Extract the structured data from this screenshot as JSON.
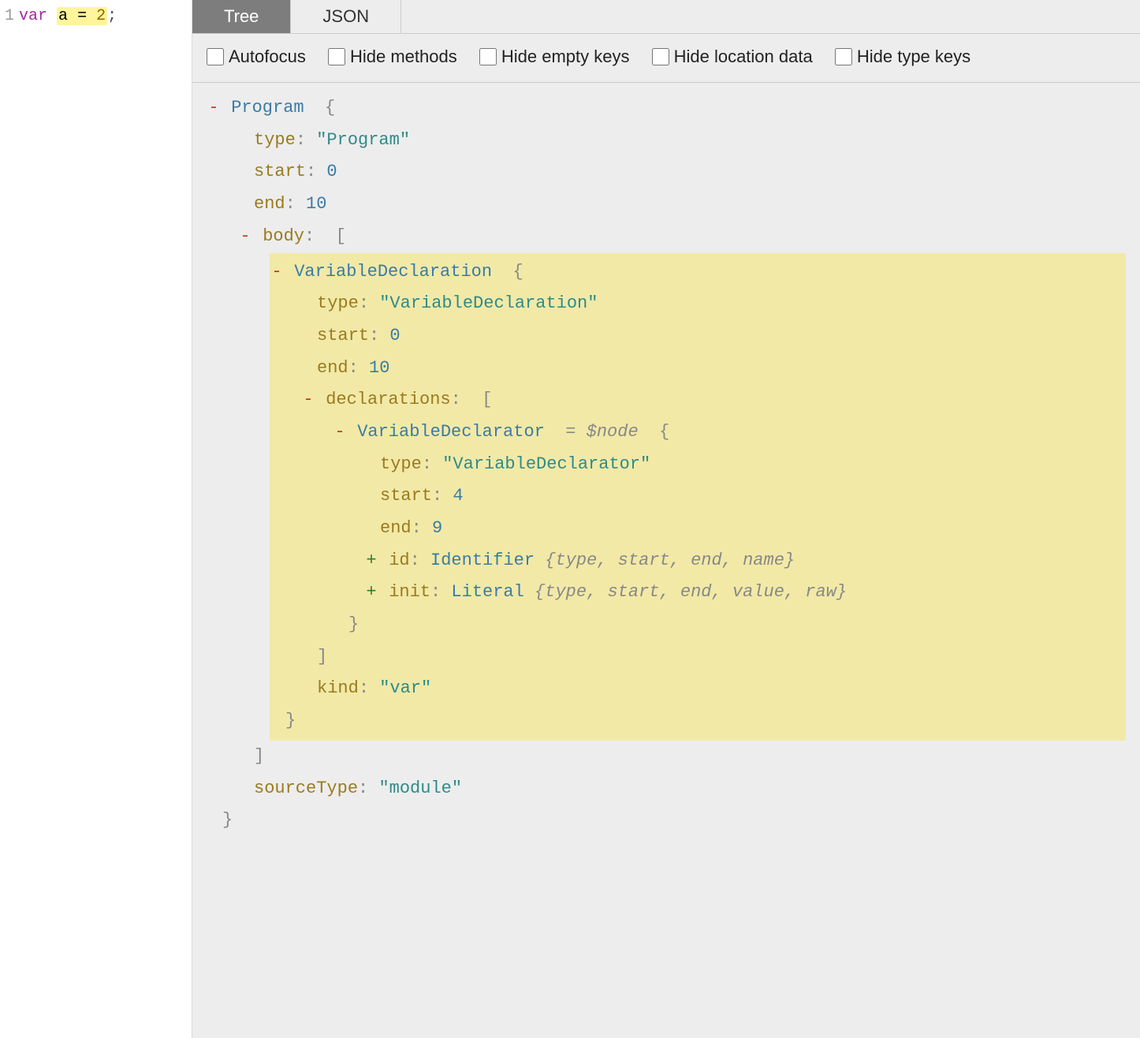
{
  "editor": {
    "line_number": "1",
    "code": {
      "keyword": "var",
      "variable": "a",
      "operator": "=",
      "number": "2",
      "semi": ";"
    },
    "highlighted": "a = 2"
  },
  "tabs": {
    "tree": "Tree",
    "json": "JSON"
  },
  "options": {
    "autofocus": "Autofocus",
    "hide_methods": "Hide methods",
    "hide_empty_keys": "Hide empty keys",
    "hide_location_data": "Hide location data",
    "hide_type_keys": "Hide type keys"
  },
  "tree": {
    "minus": "-",
    "plus": "+",
    "brace_open": "{",
    "brace_close": "}",
    "bracket_open": "[",
    "bracket_close": "]",
    "colon": ":",
    "eq": " = ",
    "program": {
      "name": "Program",
      "type_key": "type",
      "type_val": "\"Program\"",
      "start_key": "start",
      "start_val": "0",
      "end_key": "end",
      "end_val": "10",
      "body_key": "body",
      "source_type_key": "sourceType",
      "source_type_val": "\"module\""
    },
    "vdecl": {
      "name": "VariableDeclaration",
      "type_key": "type",
      "type_val": "\"VariableDeclaration\"",
      "start_key": "start",
      "start_val": "0",
      "end_key": "end",
      "end_val": "10",
      "decls_key": "declarations",
      "kind_key": "kind",
      "kind_val": "\"var\""
    },
    "vdeclr": {
      "name": "VariableDeclarator",
      "dollar": "$node",
      "type_key": "type",
      "type_val": "\"VariableDeclarator\"",
      "start_key": "start",
      "start_val": "4",
      "end_key": "end",
      "end_val": "9",
      "id_key": "id",
      "id_name": "Identifier",
      "id_summary": "{type, start, end, name}",
      "init_key": "init",
      "init_name": "Literal",
      "init_summary": "{type, start, end, value, raw}"
    }
  }
}
